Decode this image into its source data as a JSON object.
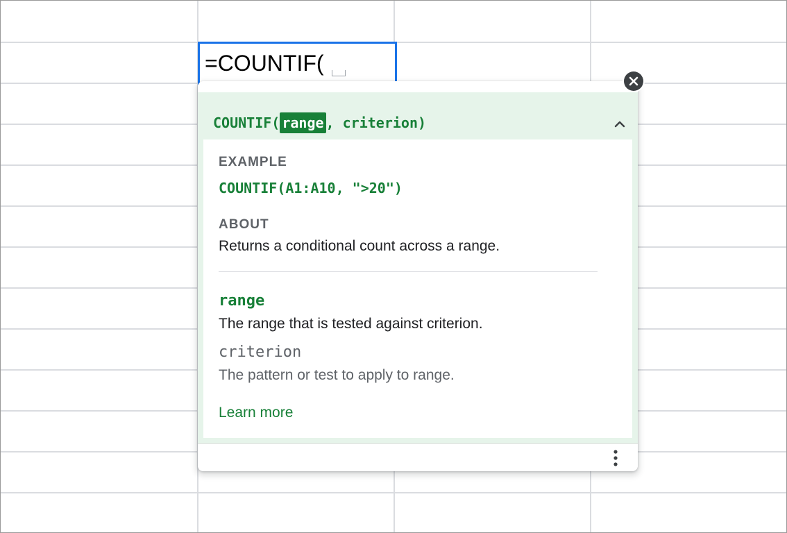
{
  "cell_editor": {
    "formula_text": "=COUNTIF("
  },
  "function_help": {
    "signature": {
      "function_name": "COUNTIF(",
      "active_arg": "range",
      "rest": ", criterion)"
    },
    "example": {
      "label": "EXAMPLE",
      "code": "COUNTIF(A1:A10, \">20\")"
    },
    "about": {
      "label": "ABOUT",
      "text": "Returns a conditional count across a range."
    },
    "arguments": [
      {
        "name": "range",
        "description": "The range that is tested against criterion."
      },
      {
        "name": "criterion",
        "description": "The pattern or test to apply to range."
      }
    ],
    "learn_more_label": "Learn more"
  },
  "icons": {
    "close": "close-icon",
    "collapse": "chevron-up-icon",
    "more": "more-vert-icon"
  },
  "colors": {
    "accent_green": "#188038",
    "header_bg": "#e6f4ea",
    "selection_blue": "#1a73e8",
    "grid_line": "#dadce0"
  }
}
